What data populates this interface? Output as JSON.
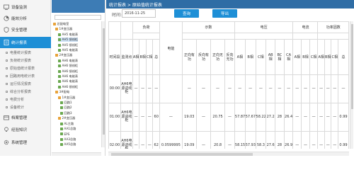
{
  "nav": {
    "items": [
      {
        "label": "设备监测",
        "icon": "monitor-icon"
      },
      {
        "label": "能效分析",
        "icon": "chart-icon"
      },
      {
        "label": "安全管理",
        "icon": "shield-icon"
      },
      {
        "label": "统计报表",
        "icon": "report-icon",
        "active": true
      },
      {
        "label": "档案管理",
        "icon": "archive-icon"
      },
      {
        "label": "经验知识",
        "icon": "bulb-icon"
      },
      {
        "label": "系统管理",
        "icon": "gear-icon"
      }
    ],
    "sub_items": [
      "电量统计报表",
      "负荷统计报表",
      "原始值统计报表",
      "回路用电统计表",
      "运行情况报表",
      "综合分析报表",
      "电费分析",
      "设备统计"
    ]
  },
  "tree": {
    "nodes": [
      "总配电室",
      "1#变压器",
      "AH5 电能表",
      "AH5 馈线柜",
      "AH5 馈线柜",
      "AH5 电能表",
      "2#变压器",
      "AH6 电能表",
      "AH6 馈线柜",
      "AH6 馈线柜",
      "AH6 电能表",
      "AH6 电能表",
      "AH6 馈线柜",
      "3#配电",
      "1#变压器",
      "回路1",
      "回路2",
      "回路3",
      "2#变压器",
      "AL主路",
      "AA1总路",
      "EPS",
      "AA3总路",
      "AA5总路"
    ]
  },
  "header": {
    "breadcrumb": "统计报表 > 原始值统计报表",
    "time_label": "时间:",
    "date_value": "2016-11-25",
    "query_label": "查询",
    "export_label": "导出"
  },
  "table": {
    "group_headers": [
      "时间段",
      "监测点",
      "负荷",
      "电能",
      "示数",
      "电压",
      "电流",
      "功率因数"
    ],
    "sub_headers": [
      "A相",
      "B相",
      "C相",
      "总",
      "正向有功",
      "反向有功",
      "正向无功",
      "反向无功",
      "A相",
      "B相",
      "C相",
      "AB相",
      "BC相",
      "CA相",
      "A相",
      "B相",
      "C相",
      "A相",
      "B相",
      "C相",
      "总"
    ],
    "rows": [
      {
        "time": "00:00",
        "point": "AH6电源进线柜",
        "load_a": "—",
        "load_b": "—",
        "load_c": "—",
        "load_total": "—",
        "energy": "",
        "pos_active": "—",
        "rev_active": "—",
        "pos_reactive": "—",
        "rev_reactive": "—",
        "ua": "—",
        "ub": "—",
        "uc": "—",
        "uab": "—",
        "ubc": "—",
        "uca": "—",
        "ia": "—",
        "ib": "—",
        "ic": "—",
        "pfa": "—",
        "pfb": "—",
        "pfc": "—",
        "pft": "—"
      },
      {
        "time": "01:00",
        "point": "AH6电源进线柜",
        "load_a": "—",
        "load_b": "—",
        "load_c": "—",
        "load_total": "60",
        "energy": "—",
        "pos_active": "19.03",
        "rev_active": "—",
        "pos_reactive": "20.75",
        "rev_reactive": "—",
        "ua": "57.87",
        "ub": "57.67",
        "uc": "58.22",
        "uab": "27.2",
        "ubc": "28",
        "uca": "26.4",
        "ia": "—",
        "ib": "—",
        "ic": "—",
        "pfa": "—",
        "pfb": "—",
        "pfc": "—",
        "pft": "0.99"
      },
      {
        "time": "02:00",
        "point": "AH6电源进线柜",
        "load_a": "—",
        "load_b": "—",
        "load_c": "—",
        "load_total": "62",
        "energy": "0.0599995",
        "pos_active": "19.09",
        "rev_active": "—",
        "pos_reactive": "20.8",
        "rev_reactive": "—",
        "ua": "58.15",
        "ub": "57.93",
        "uc": "58.3",
        "uab": "27.6",
        "ubc": "28",
        "uca": "26.9",
        "ia": "—",
        "ib": "—",
        "ic": "—",
        "pfa": "—",
        "pfb": "—",
        "pfc": "—",
        "pft": "0.99"
      }
    ]
  },
  "colors": {
    "accent": "#1e8fd6",
    "header_bar": "#2f6da5",
    "active_nav": "#1e8fd6"
  }
}
